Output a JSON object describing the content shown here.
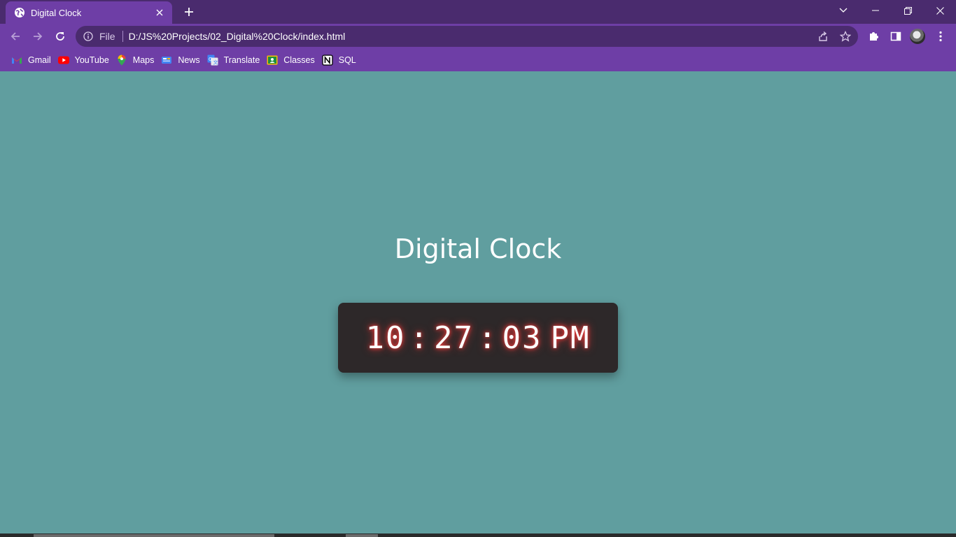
{
  "browser": {
    "tab": {
      "title": "Digital Clock"
    },
    "address": {
      "scheme": "File",
      "url": "D:/JS%20Projects/02_Digital%20Clock/index.html"
    },
    "bookmarks": [
      {
        "label": "Gmail",
        "icon": "gmail-icon"
      },
      {
        "label": "YouTube",
        "icon": "youtube-icon"
      },
      {
        "label": "Maps",
        "icon": "maps-icon"
      },
      {
        "label": "News",
        "icon": "news-icon"
      },
      {
        "label": "Translate",
        "icon": "translate-icon"
      },
      {
        "label": "Classes",
        "icon": "classes-icon"
      },
      {
        "label": "SQL",
        "icon": "notion-icon"
      }
    ],
    "colors": {
      "titlebar": "#4a2b6e",
      "toolbar": "#6e3ea6"
    }
  },
  "page": {
    "heading": "Digital Clock",
    "clock": {
      "hours": "10",
      "minutes": "27",
      "seconds": "03",
      "separator": ":",
      "period": "PM"
    },
    "colors": {
      "background": "#609e9f",
      "clock_bg": "#2d2829",
      "glow": "#ff3b3b"
    }
  }
}
